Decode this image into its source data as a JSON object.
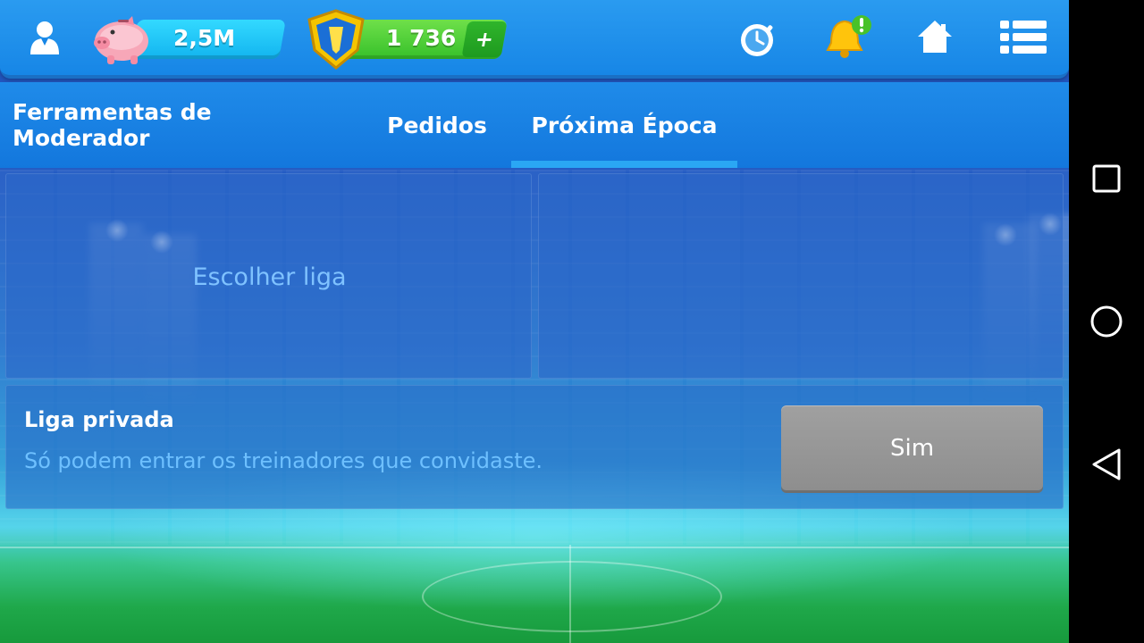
{
  "topbar": {
    "money": "2,5M",
    "coins": "1 736",
    "add_label": "+",
    "icons": {
      "profile": "manager-icon",
      "piggy": "piggy-bank-icon",
      "shield": "shield-icon",
      "clock": "clock-icon",
      "bell": "bell-icon",
      "home": "home-icon",
      "menu": "menu-icon"
    },
    "notification_badge": "!"
  },
  "tabs": [
    {
      "label": "Ferramentas de Moderador",
      "active": false
    },
    {
      "label": "Pedidos",
      "active": false
    },
    {
      "label": "Próxima Época",
      "active": true
    }
  ],
  "league": {
    "choose_label": "Escolher liga"
  },
  "private_league": {
    "title": "Liga privada",
    "description": "Só podem entrar os treinadores que convidaste.",
    "button_label": "Sim"
  },
  "colors": {
    "accent_blue": "#1786e6",
    "money_cyan": "#12b4ef",
    "coins_green": "#36c02a",
    "link_blue": "#6ec0ff",
    "disabled_button": "#8e8e8e"
  },
  "android_nav": {
    "icons": [
      "recents-square-icon",
      "home-circle-icon",
      "back-triangle-icon"
    ]
  }
}
